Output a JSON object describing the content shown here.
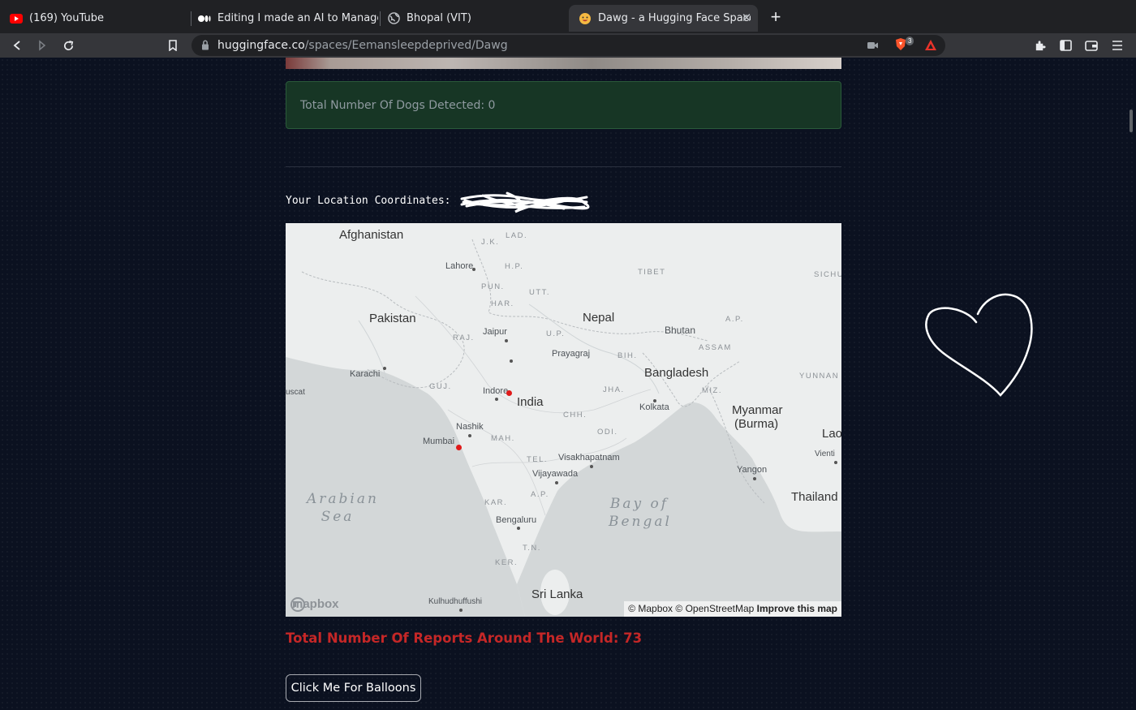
{
  "browser": {
    "tabs": [
      {
        "title": "(169) YouTube",
        "icon": "youtube-icon"
      },
      {
        "title": "Editing I made an AI to Manage Stre",
        "icon": "medium-icon"
      },
      {
        "title": "Bhopal (VIT)",
        "icon": "globe-icon"
      },
      {
        "title": "Dawg - a Hugging Face Space b",
        "icon": "huggingface-icon",
        "active": true
      }
    ],
    "url_host": "huggingface.co",
    "url_path": "/spaces/Eemansleepdeprived/Dawg",
    "extension_badge": "3"
  },
  "page": {
    "dogs_detected_text": "Total Number Of Dogs Detected: 0",
    "coordinates_label": "Your Location Coordinates:",
    "reports_text": "Total Number Of Reports Around The World: 73",
    "balloon_button": "Click Me For Balloons"
  },
  "map": {
    "countries": [
      "Afghanistan",
      "Pakistan",
      "Nepal",
      "Bhutan",
      "Bangladesh",
      "India",
      "Myanmar",
      "(Burma)",
      "Sri Lanka",
      "Thailand",
      "Lao"
    ],
    "states": [
      "J.K.",
      "LAD.",
      "H.P.",
      "PUN.",
      "UTT.",
      "HAR.",
      "TIBET",
      "SICHU",
      "RAJ.",
      "U.P.",
      "A.P.",
      "BIH.",
      "ASSAM",
      "GUJ.",
      "JHA.",
      "MIZ.",
      "YUNNAN",
      "CHH.",
      "MAH.",
      "ODI.",
      "TEL.",
      "A.P.",
      "KAR.",
      "T.N.",
      "KER."
    ],
    "cities": [
      "Lahore",
      "Jaipur",
      "Prayagraj",
      "Karachi",
      "Indore",
      "Kolkata",
      "Nashik",
      "Mumbai",
      "Visakhapatnam",
      "Vijayawada",
      "Yangon",
      "Bengaluru",
      "Kulhudhuffushi",
      "Vienti",
      "uscat"
    ],
    "seas": [
      "Arabian",
      "Sea",
      "Bay of",
      "Bengal"
    ],
    "attribution_mapbox": "© Mapbox",
    "attribution_osm": "© OpenStreetMap",
    "attribution_improve": "Improve this map",
    "logo_text": "mapbox"
  }
}
